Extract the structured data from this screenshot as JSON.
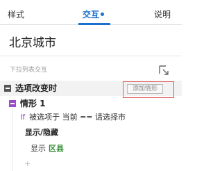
{
  "tabs": {
    "style": "样式",
    "interaction": "交互",
    "notes": "说明"
  },
  "widget": {
    "name": "北京城市",
    "type": "下拉列表交互"
  },
  "event": {
    "label": "选项改变时",
    "add_case_label": "添加情形"
  },
  "case": {
    "label": "情形 1",
    "condition_keyword": "If",
    "condition_text": "被选项于 当前 == 请选择市",
    "action_label": "显示/隐藏",
    "action_verb": "显示",
    "action_target": "区县",
    "add_symbol": "+"
  },
  "colors": {
    "accent": "#1a6fd1",
    "case_purple": "#9b4dca",
    "target_green": "#2e8b2e",
    "highlight_red": "#e05a5a"
  }
}
